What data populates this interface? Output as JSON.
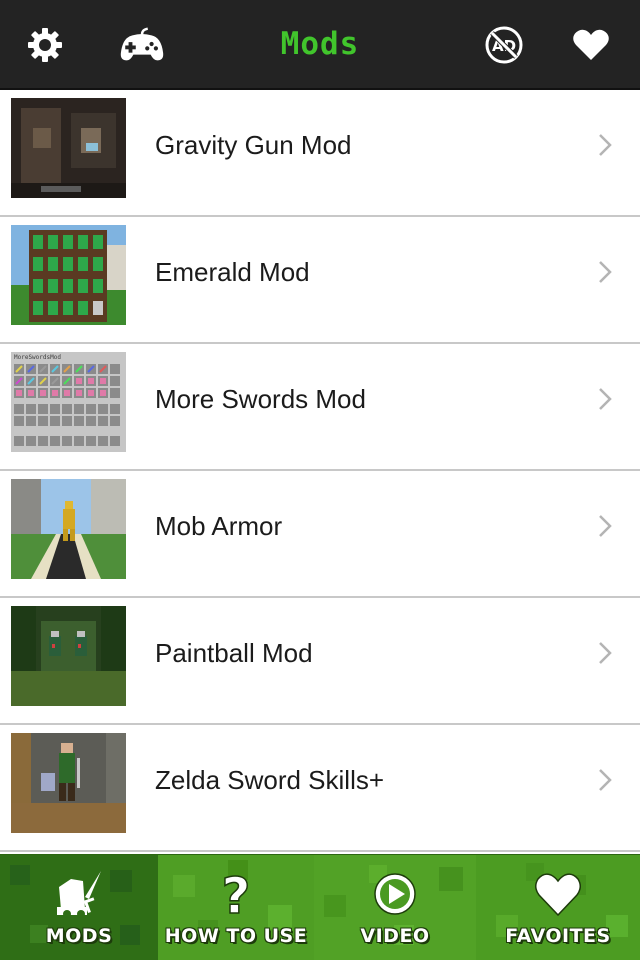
{
  "header": {
    "title": "Mods",
    "icons": [
      "gear-icon",
      "gamepad-icon",
      "no-ads-icon",
      "heart-icon"
    ],
    "title_color": "#41c52c"
  },
  "mods": [
    {
      "name": "Gravity Gun Mod"
    },
    {
      "name": "Emerald Mod"
    },
    {
      "name": "More Swords Mod",
      "thumb_caption": "MoreSwordsMod"
    },
    {
      "name": "Mob Armor"
    },
    {
      "name": "Paintball Mod"
    },
    {
      "name": "Zelda Sword Skills+"
    }
  ],
  "tabs": [
    {
      "label": "MODS",
      "icon": "sword-icon",
      "active": true
    },
    {
      "label": "HOW TO USE",
      "icon": "question-icon"
    },
    {
      "label": "VIDEO",
      "icon": "play-icon"
    },
    {
      "label": "FAVOITES",
      "icon": "heart-icon"
    }
  ],
  "colors": {
    "header_bg": "#232323",
    "tab_green": "#4a9a22",
    "tab_active": "#2e6d15",
    "separator": "#c8c8c8"
  }
}
